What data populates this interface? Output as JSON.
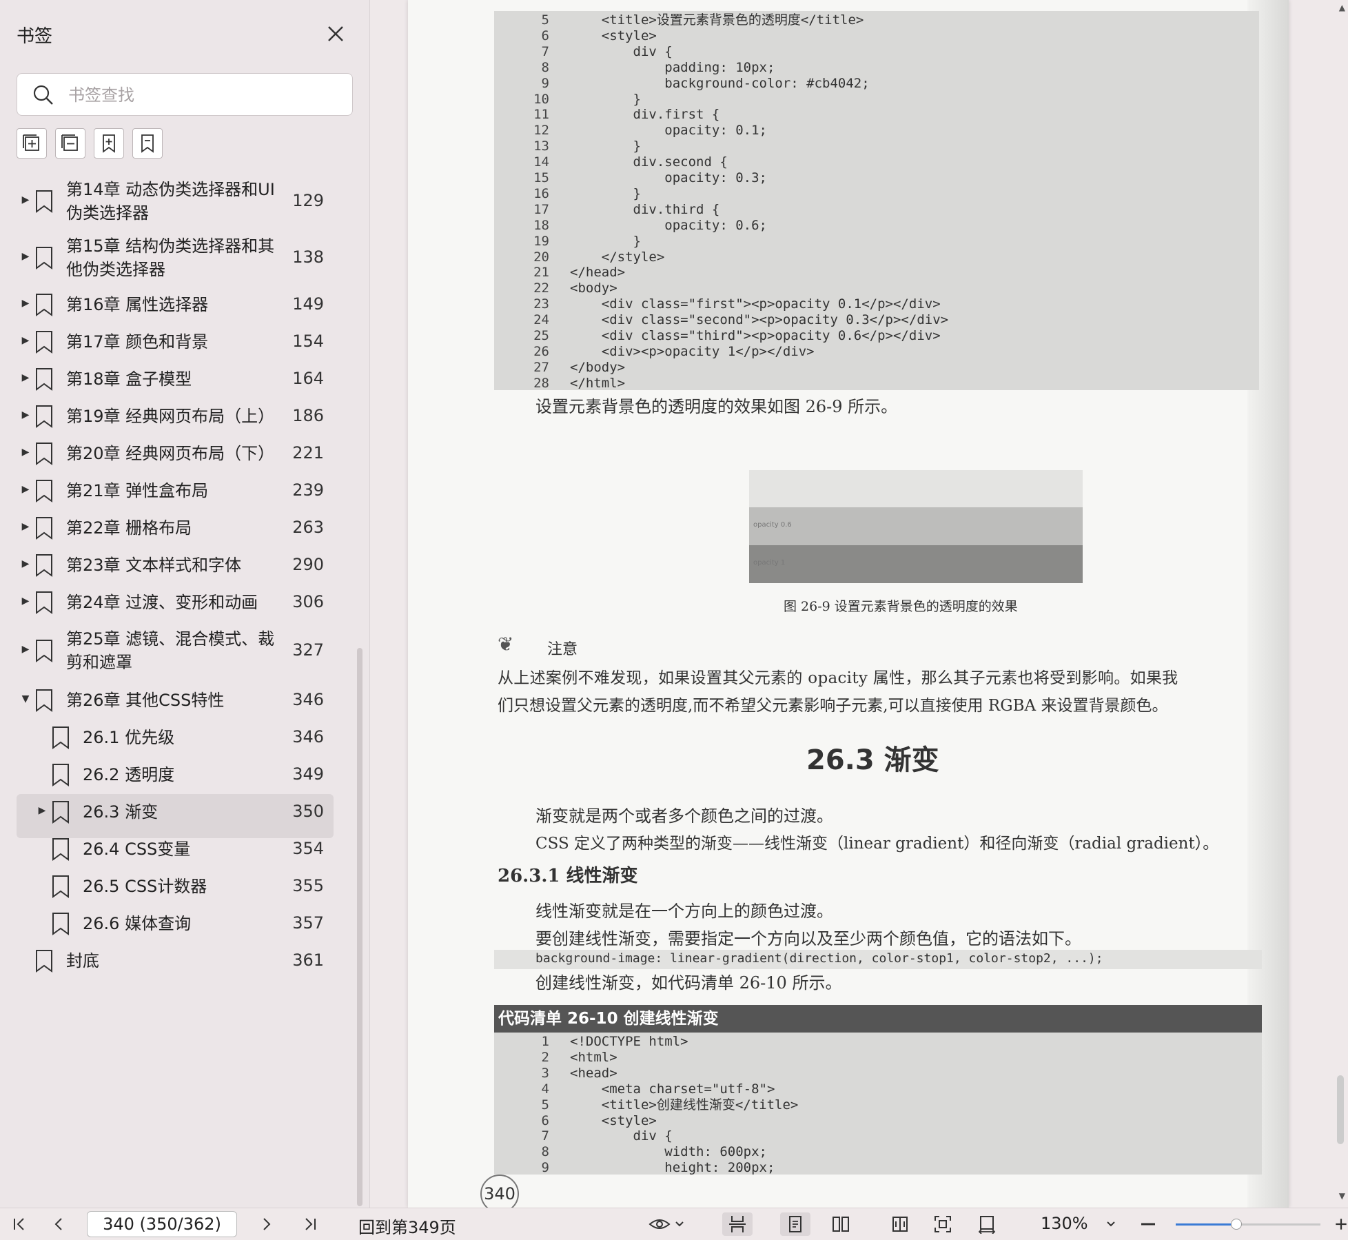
{
  "sidebar": {
    "title": "书签",
    "search_placeholder": "书签查找",
    "bookmarks": [
      {
        "label": "第14章  动态伪类选择器和UI伪类选择器",
        "line1": "第14章  动态伪类选择器和UI",
        "line2": "伪类选择器",
        "page": "129"
      },
      {
        "label": "第15章  结构伪类选择器和其他伪类选择器",
        "line1": "第15章  结构伪类选择器和其",
        "line2": "他伪类选择器",
        "page": "138"
      },
      {
        "label": "第16章  属性选择器",
        "page": "149"
      },
      {
        "label": "第17章  颜色和背景",
        "page": "154"
      },
      {
        "label": "第18章  盒子模型",
        "page": "164"
      },
      {
        "label": "第19章  经典网页布局（上）",
        "page": "186"
      },
      {
        "label": "第20章  经典网页布局（下）",
        "page": "221"
      },
      {
        "label": "第21章  弹性盒布局",
        "page": "239"
      },
      {
        "label": "第22章  栅格布局",
        "page": "263"
      },
      {
        "label": "第23章  文本样式和字体",
        "page": "290"
      },
      {
        "label": "第24章  过渡、变形和动画",
        "page": "306"
      },
      {
        "label": "第25章  滤镜、混合模式、裁剪和遮罩",
        "line1": "第25章  滤镜、混合模式、裁",
        "line2": "剪和遮罩",
        "page": "327"
      },
      {
        "label": "第26章  其他CSS特性",
        "page": "346"
      },
      {
        "label": "26.1  优先级",
        "page": "346"
      },
      {
        "label": "26.2  透明度",
        "page": "349"
      },
      {
        "label": "26.3  渐变",
        "page": "350"
      },
      {
        "label": "26.4  CSS变量",
        "page": "354"
      },
      {
        "label": "26.5  CSS计数器",
        "page": "355"
      },
      {
        "label": "26.6  媒体查询",
        "page": "357"
      },
      {
        "label": "封底",
        "page": "361"
      }
    ]
  },
  "document": {
    "code_top": [
      {
        "n": "5",
        "t": "    <title>设置元素背景色的透明度</title>"
      },
      {
        "n": "6",
        "t": "    <style>"
      },
      {
        "n": "7",
        "t": "        div {"
      },
      {
        "n": "8",
        "t": "            padding: 10px;"
      },
      {
        "n": "9",
        "t": "            background-color: #cb4042;"
      },
      {
        "n": "10",
        "t": "        }"
      },
      {
        "n": "11",
        "t": "        div.first {"
      },
      {
        "n": "12",
        "t": "            opacity: 0.1;"
      },
      {
        "n": "13",
        "t": "        }"
      },
      {
        "n": "14",
        "t": "        div.second {"
      },
      {
        "n": "15",
        "t": "            opacity: 0.3;"
      },
      {
        "n": "16",
        "t": "        }"
      },
      {
        "n": "17",
        "t": "        div.third {"
      },
      {
        "n": "18",
        "t": "            opacity: 0.6;"
      },
      {
        "n": "19",
        "t": "        }"
      },
      {
        "n": "20",
        "t": "    </style>"
      },
      {
        "n": "21",
        "t": "</head>"
      },
      {
        "n": "22",
        "t": "<body>"
      },
      {
        "n": "23",
        "t": "    <div class=\"first\"><p>opacity 0.1</p></div>"
      },
      {
        "n": "24",
        "t": "    <div class=\"second\"><p>opacity 0.3</p></div>"
      },
      {
        "n": "25",
        "t": "    <div class=\"third\"><p>opacity 0.6</p></div>"
      },
      {
        "n": "26",
        "t": "    <div><p>opacity 1</p></div>"
      },
      {
        "n": "27",
        "t": "</body>"
      },
      {
        "n": "28",
        "t": "</html>"
      }
    ],
    "effect_text": "设置元素背景色的透明度的效果如图 26-9 所示。",
    "figure_rows": [
      "opacity 0.6",
      "opacity 1"
    ],
    "figure_caption": "图 26-9   设置元素背景色的透明度的效果",
    "note_label": "注意",
    "note_line1": "从上述案例不难发现，如果设置其父元素的 opacity 属性，那么其子元素也将受到影响。如果我",
    "note_line2": "们只想设置父元素的透明度,而不希望父元素影响子元素,可以直接使用 RGBA 来设置背景颜色。",
    "section_title": "26.3   渐变",
    "para1": "渐变就是两个或者多个颜色之间的过渡。",
    "para2": "CSS 定义了两种类型的渐变——线性渐变（linear gradient）和径向渐变（radial gradient）。",
    "subsection": "26.3.1   线性渐变",
    "para3": "线性渐变就是在一个方向上的颜色过渡。",
    "para4": "要创建线性渐变，需要指定一个方向以及至少两个颜色值，它的语法如下。",
    "syntax": "background-image: linear-gradient(direction, color-stop1, color-stop2, ...);",
    "para5": "创建线性渐变，如代码清单 26-10 所示。",
    "listing_title": "代码清单 26-10   创建线性渐变",
    "code_bottom": [
      {
        "n": "1",
        "t": "<!DOCTYPE html>"
      },
      {
        "n": "2",
        "t": "<html>"
      },
      {
        "n": "3",
        "t": "<head>"
      },
      {
        "n": "4",
        "t": "    <meta charset=\"utf-8\">"
      },
      {
        "n": "5",
        "t": "    <title>创建线性渐变</title>"
      },
      {
        "n": "6",
        "t": "    <style>"
      },
      {
        "n": "7",
        "t": "        div {"
      },
      {
        "n": "8",
        "t": "            width: 600px;"
      },
      {
        "n": "9",
        "t": "            height: 200px;"
      }
    ],
    "page_number": "340"
  },
  "toolbar": {
    "page_field": "340 (350/362)",
    "back_to": "回到第349页",
    "zoom": "130%",
    "zoom_level": 0.42,
    "accent": "#3a7bd5"
  }
}
